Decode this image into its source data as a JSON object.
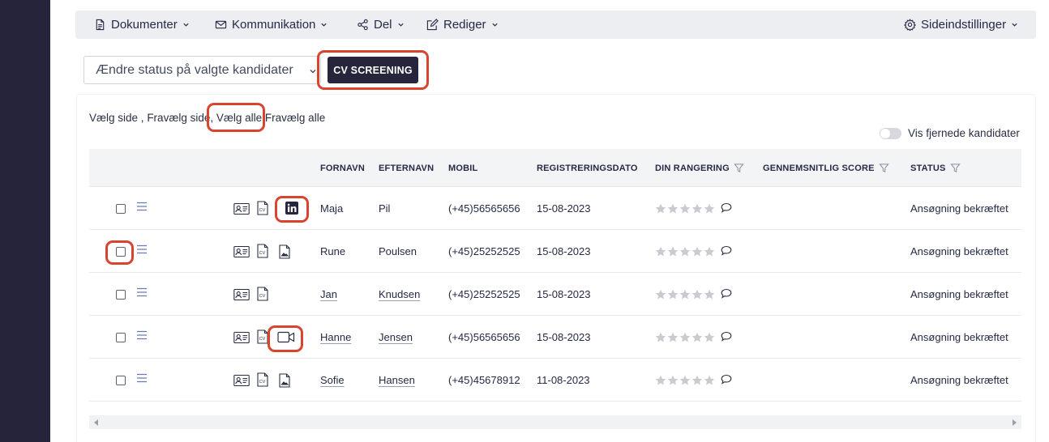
{
  "toolbar": {
    "documents": "Dokumenter",
    "communication": "Kommunikation",
    "share": "Del",
    "edit": "Rediger",
    "page_settings": "Sideindstillinger"
  },
  "actions": {
    "status_select_value": "Ændre status på valgte kandidater",
    "cv_screening_label": "CV SCREENING"
  },
  "selection_links": {
    "select_page": "Vælg side ,",
    "deselect_page": "Fravælg side",
    "sep": ",",
    "select_all": "Vælg alle",
    "deselect_all": "Fravælg alle"
  },
  "show_removed_label": "Vis fjernede kandidater",
  "table": {
    "headers": {
      "first_name": "FORNAVN",
      "last_name": "EFTERNAVN",
      "mobile": "MOBIL",
      "reg_date": "REGISTRERINGSDATO",
      "your_rating": "DIN RANGERING",
      "avg_score": "GENNEMSNITLIG SCORE",
      "status": "STATUS"
    },
    "rows": [
      {
        "first_name": "Maja",
        "last_name": "Pil",
        "mobile": "(+45)56565656",
        "reg_date": "15-08-2023",
        "status": "Ansøgning bekræftet",
        "linked_name": false,
        "extra_icon": "linkedin-icon"
      },
      {
        "first_name": "Rune",
        "last_name": "Poulsen",
        "mobile": "(+45)25252525",
        "reg_date": "15-08-2023",
        "status": "Ansøgning bekræftet",
        "linked_name": false,
        "extra_icon": "image-file-icon"
      },
      {
        "first_name": "Jan",
        "last_name": "Knudsen",
        "mobile": "(+45)25252525",
        "reg_date": "15-08-2023",
        "status": "Ansøgning bekræftet",
        "linked_name": true,
        "extra_icon": ""
      },
      {
        "first_name": "Hanne",
        "last_name": "Jensen",
        "mobile": "(+45)56565656",
        "reg_date": "15-08-2023",
        "status": "Ansøgning bekræftet",
        "linked_name": true,
        "extra_icon": "video-icon"
      },
      {
        "first_name": "Sofie",
        "last_name": "Hansen",
        "mobile": "(+45)45678912",
        "reg_date": "11-08-2023",
        "status": "Ansøgning bekræftet",
        "linked_name": true,
        "extra_icon": "image-file-icon"
      }
    ]
  },
  "colors": {
    "sidebar": "#25243a",
    "primary_button": "#26253b",
    "highlight": "#d9442f",
    "toolbar_bg": "#eceef2"
  }
}
